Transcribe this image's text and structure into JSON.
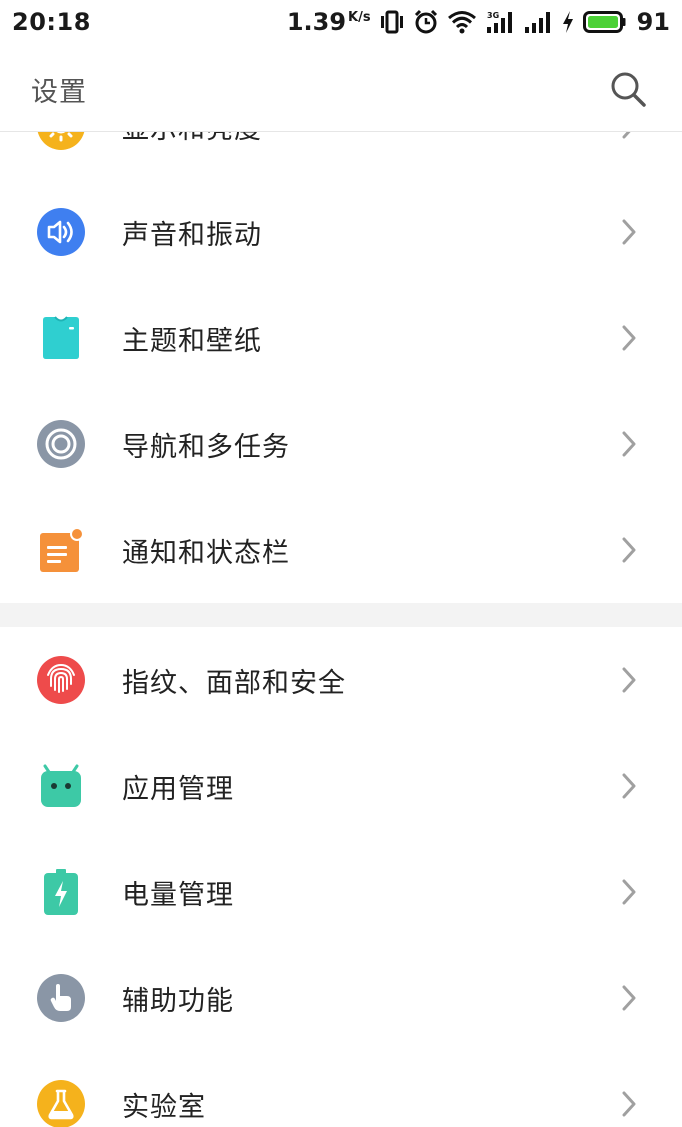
{
  "status": {
    "time": "20:18",
    "net_speed": "1.39",
    "net_unit": "K/s",
    "signal_label": "3G",
    "battery": "91"
  },
  "header": {
    "title": "设置",
    "search_icon": "search-icon"
  },
  "sections": [
    {
      "items": [
        {
          "label": "显示和亮度",
          "icon": "sun-icon",
          "color": "#f5b21c"
        },
        {
          "label": "声音和振动",
          "icon": "speaker-icon",
          "color": "#3f7ff0"
        },
        {
          "label": "主题和壁纸",
          "icon": "tshirt-icon",
          "color": "#2fcfd0"
        },
        {
          "label": "导航和多任务",
          "icon": "ring-icon",
          "color": "#8a96a6"
        },
        {
          "label": "通知和状态栏",
          "icon": "notification-icon",
          "color": "#f5913a"
        }
      ]
    },
    {
      "items": [
        {
          "label": "指纹、面部和安全",
          "icon": "fingerprint-icon",
          "color": "#ee4b4b"
        },
        {
          "label": "应用管理",
          "icon": "android-icon",
          "color": "#3dc9a6"
        },
        {
          "label": "电量管理",
          "icon": "battery-bolt-icon",
          "color": "#3dc9a6"
        },
        {
          "label": "辅助功能",
          "icon": "hand-icon",
          "color": "#8a96a6"
        },
        {
          "label": "实验室",
          "icon": "flask-icon",
          "color": "#f5b21c"
        }
      ]
    }
  ],
  "colors": {
    "chevron": "#a0a0a0",
    "battery_fill": "#4cd137",
    "section_gap": "#f3f3f3"
  }
}
